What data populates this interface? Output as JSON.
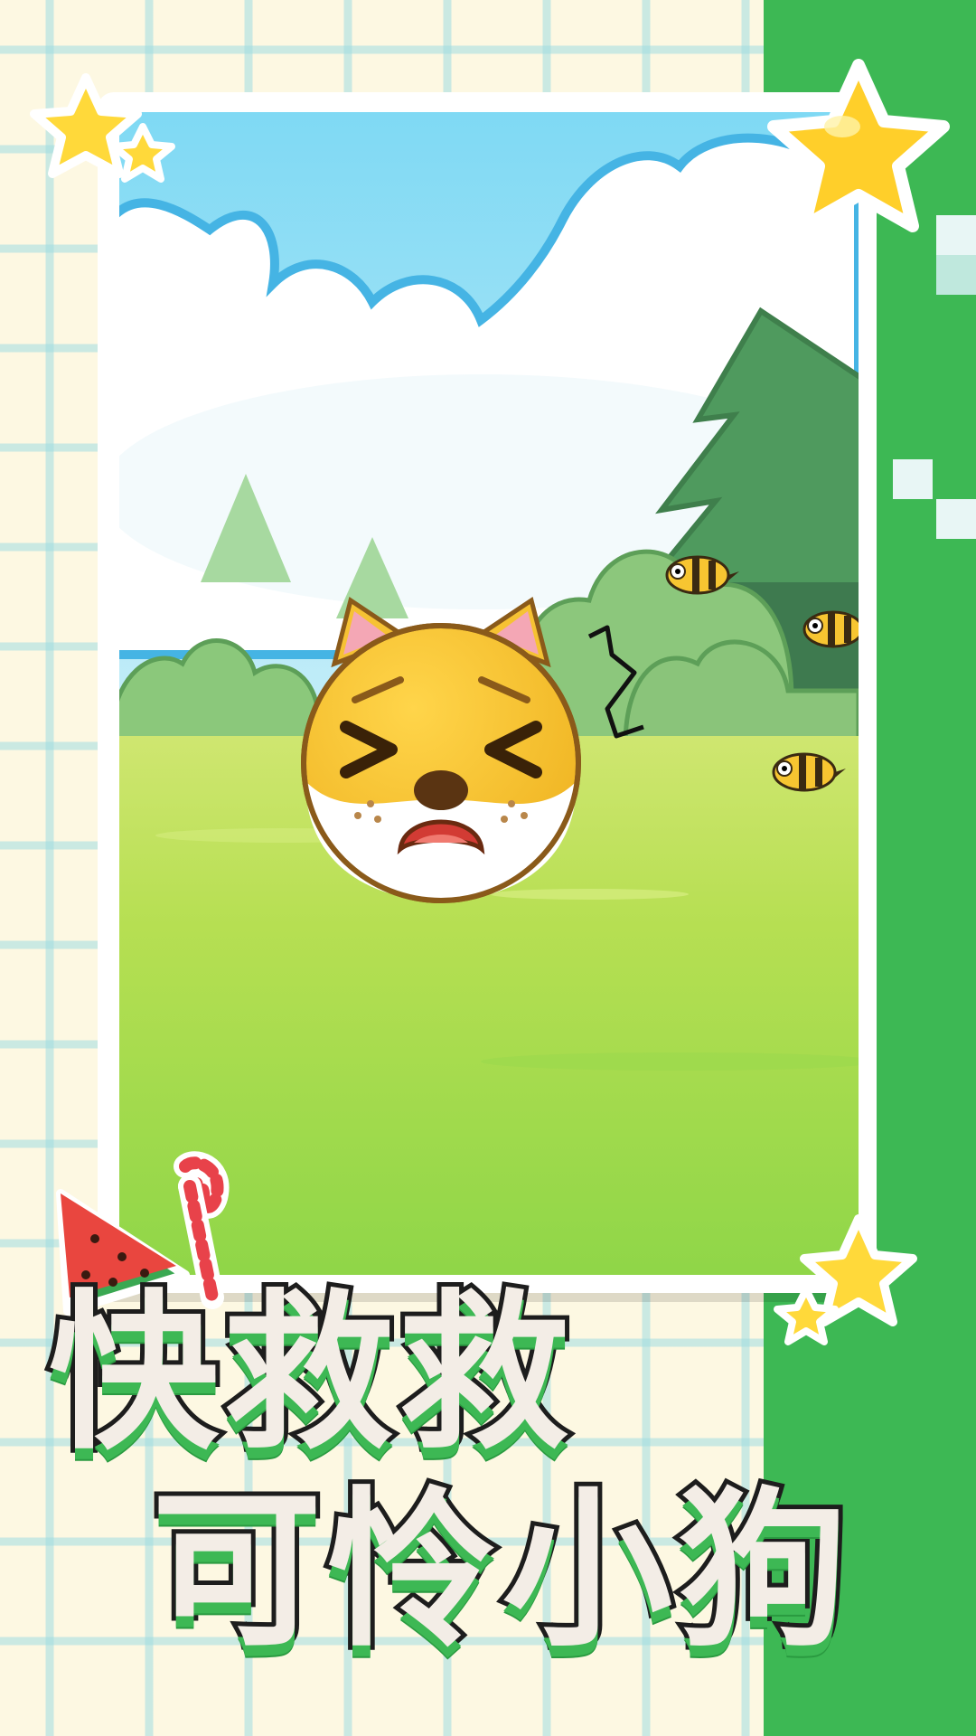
{
  "screen": {
    "title_line1": "快救救",
    "title_line2": "可怜小狗"
  },
  "colors": {
    "background_cream": "#fdf8e2",
    "grid_cross": "#a0dce1",
    "green_strip": "#3db854",
    "sky": "#84d8f0",
    "grass": "#a6dc46",
    "dog_yellow": "#f6c233",
    "title_fill": "#f3ede6",
    "title_outline": "#1d1d1d"
  },
  "icons": [
    "star-icon",
    "watermelon-icon",
    "candy-cane-icon",
    "bee-icon",
    "dog-face-icon",
    "pine-tree-icon",
    "scribble-line-icon"
  ]
}
